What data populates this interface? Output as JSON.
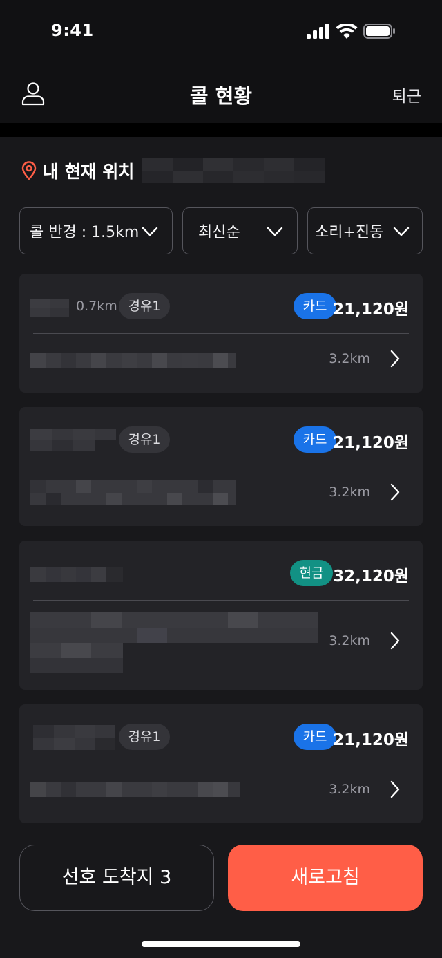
{
  "status_bar": {
    "time": "9:41",
    "icons": [
      "cellular-signal-icon",
      "wifi-icon",
      "battery-icon"
    ]
  },
  "header": {
    "title": "콜 현황",
    "right_action": "퇴근",
    "left_icon": "profile-icon"
  },
  "location": {
    "label": "내 현재 위치",
    "icon": "location-pin-icon",
    "value_redacted": true
  },
  "filters": [
    {
      "label": "콜 반경 : 1.5km"
    },
    {
      "label": "최신순"
    },
    {
      "label": "소리+진동"
    }
  ],
  "calls": [
    {
      "distance": "0.7km",
      "fuel": "경유1",
      "payment": "카드",
      "fare": "21,120원",
      "dest_distance": "3.2km"
    },
    {
      "distance": "",
      "fuel": "경유1",
      "payment": "카드",
      "fare": "21,120원",
      "dest_distance": "3.2km"
    },
    {
      "distance": "",
      "fuel": "",
      "payment": "현금",
      "fare": "32,120원",
      "dest_distance": "3.2km"
    },
    {
      "distance": "",
      "fuel": "경유1",
      "payment": "카드",
      "fare": "21,120원",
      "dest_distance": "3.2km"
    }
  ],
  "bottom": {
    "favorite_button": "선호 도착지 3",
    "refresh_button": "새로고침"
  },
  "colors": {
    "accent": "#ff5e47",
    "card_payment": "#1a73e8",
    "cash_payment": "#129184",
    "location_icon": "#ff5e47"
  }
}
